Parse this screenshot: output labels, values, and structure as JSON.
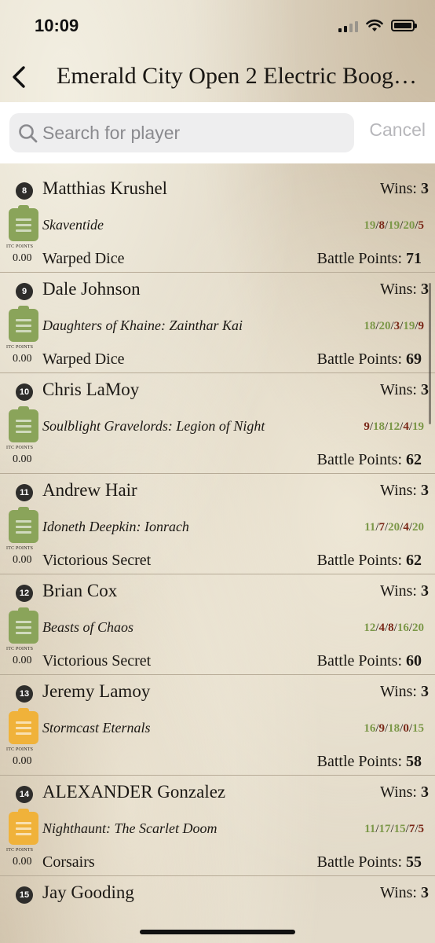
{
  "status_bar": {
    "time": "10:09"
  },
  "nav": {
    "title": "Emerald City Open 2 Electric Boog…"
  },
  "search": {
    "placeholder": "Search for player",
    "value": "",
    "cancel_label": "Cancel"
  },
  "colors": {
    "list_icon_green": "#8aa45a",
    "list_icon_orange": "#f0b23a",
    "score_green": "#7c9849",
    "score_red": "#7a2818",
    "rank_badge": "#2e2d2b"
  },
  "labels": {
    "wins": "Wins:",
    "battle_points": "Battle Points:",
    "itc_points": "ITC POINTS"
  },
  "players": [
    {
      "rank": "8",
      "name": "Matthias Krushel",
      "wins": "3",
      "army": "Skaventide",
      "list_icon_color": "green",
      "scores": [
        {
          "v": "19",
          "c": "g"
        },
        {
          "v": "8",
          "c": "r"
        },
        {
          "v": "19",
          "c": "g"
        },
        {
          "v": "20",
          "c": "g"
        },
        {
          "v": "5",
          "c": "r"
        }
      ],
      "itc": "0.00",
      "team": "Warped Dice",
      "battle_points": "71"
    },
    {
      "rank": "9",
      "name": "Dale Johnson",
      "wins": "3",
      "army": "Daughters of Khaine: Zainthar Kai",
      "list_icon_color": "green",
      "scores": [
        {
          "v": "18",
          "c": "g"
        },
        {
          "v": "20",
          "c": "g"
        },
        {
          "v": "3",
          "c": "r"
        },
        {
          "v": "19",
          "c": "g"
        },
        {
          "v": "9",
          "c": "r"
        }
      ],
      "itc": "0.00",
      "team": "Warped Dice",
      "battle_points": "69"
    },
    {
      "rank": "10",
      "name": "Chris LaMoy",
      "wins": "3",
      "army": "Soulblight Gravelords: Legion of Night",
      "list_icon_color": "green",
      "scores": [
        {
          "v": "9",
          "c": "r"
        },
        {
          "v": "18",
          "c": "g"
        },
        {
          "v": "12",
          "c": "g"
        },
        {
          "v": "4",
          "c": "r"
        },
        {
          "v": "19",
          "c": "g"
        }
      ],
      "itc": "0.00",
      "team": "",
      "battle_points": "62"
    },
    {
      "rank": "11",
      "name": "Andrew Hair",
      "wins": "3",
      "army": "Idoneth Deepkin: Ionrach",
      "list_icon_color": "green",
      "scores": [
        {
          "v": "11",
          "c": "g"
        },
        {
          "v": "7",
          "c": "r"
        },
        {
          "v": "20",
          "c": "g"
        },
        {
          "v": "4",
          "c": "r"
        },
        {
          "v": "20",
          "c": "g"
        }
      ],
      "itc": "0.00",
      "team": "Victorious Secret",
      "battle_points": "62"
    },
    {
      "rank": "12",
      "name": "Brian Cox",
      "wins": "3",
      "army": "Beasts of Chaos",
      "list_icon_color": "green",
      "scores": [
        {
          "v": "12",
          "c": "g"
        },
        {
          "v": "4",
          "c": "r"
        },
        {
          "v": "8",
          "c": "r"
        },
        {
          "v": "16",
          "c": "g"
        },
        {
          "v": "20",
          "c": "g"
        }
      ],
      "itc": "0.00",
      "team": "Victorious Secret",
      "battle_points": "60"
    },
    {
      "rank": "13",
      "name": "Jeremy Lamoy",
      "wins": "3",
      "army": "Stormcast Eternals",
      "list_icon_color": "orange",
      "scores": [
        {
          "v": "16",
          "c": "g"
        },
        {
          "v": "9",
          "c": "r"
        },
        {
          "v": "18",
          "c": "g"
        },
        {
          "v": "0",
          "c": "r"
        },
        {
          "v": "15",
          "c": "g"
        }
      ],
      "itc": "0.00",
      "team": "",
      "battle_points": "58"
    },
    {
      "rank": "14",
      "name": "ALEXANDER Gonzalez",
      "wins": "3",
      "army": "Nighthaunt: The Scarlet Doom",
      "list_icon_color": "orange",
      "scores": [
        {
          "v": "11",
          "c": "g"
        },
        {
          "v": "17",
          "c": "g"
        },
        {
          "v": "15",
          "c": "g"
        },
        {
          "v": "7",
          "c": "r"
        },
        {
          "v": "5",
          "c": "r"
        }
      ],
      "itc": "0.00",
      "team": "Corsairs",
      "battle_points": "55"
    },
    {
      "rank": "15",
      "name": "Jay Gooding",
      "wins": "3",
      "army": "",
      "list_icon_color": "",
      "scores": [],
      "itc": "",
      "team": "",
      "battle_points": ""
    }
  ]
}
